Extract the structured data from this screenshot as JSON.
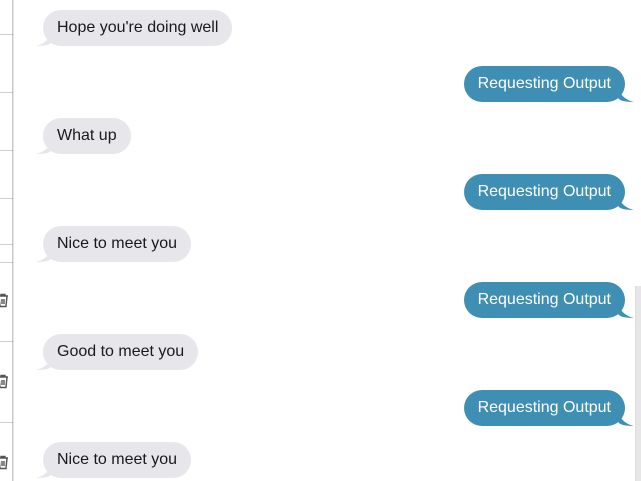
{
  "colors": {
    "incoming_bubble": "#e6e6eb",
    "outgoing_bubble": "#3f8fb5",
    "outgoing_text": "#ffffff",
    "incoming_text": "#1a1a1a"
  },
  "sidebar": {
    "icons": [
      "trash-icon",
      "trash-icon",
      "trash-icon"
    ]
  },
  "messages": [
    {
      "direction": "incoming",
      "text": "Hope you're doing well"
    },
    {
      "direction": "outgoing",
      "text": "Requesting Output"
    },
    {
      "direction": "incoming",
      "text": "What up"
    },
    {
      "direction": "outgoing",
      "text": "Requesting Output"
    },
    {
      "direction": "incoming",
      "text": "Nice to meet you"
    },
    {
      "direction": "outgoing",
      "text": "Requesting Output"
    },
    {
      "direction": "incoming",
      "text": "Good to meet you"
    },
    {
      "direction": "outgoing",
      "text": "Requesting Output"
    },
    {
      "direction": "incoming",
      "text": "Nice to meet you"
    }
  ]
}
